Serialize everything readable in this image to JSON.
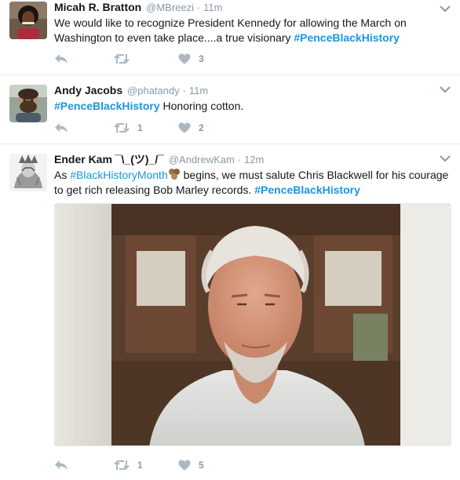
{
  "tweets": [
    {
      "name": "Micah R. Bratton",
      "handle": "@MBreezi",
      "separator": "·",
      "time": "11m",
      "text_part1": "We would like to recognize President Kennedy for allowing the March on Washington to even take place....a true visionary",
      "hashtag": "#PenceBlackHistory",
      "retweets": "",
      "likes": "3"
    },
    {
      "name": "Andy Jacobs",
      "handle": "@phatandy",
      "separator": "·",
      "time": "11m",
      "hashtag": "#PenceBlackHistory",
      "text_part2": "Honoring cotton.",
      "retweets": "1",
      "likes": "2"
    },
    {
      "name": "Ender Kam ¯\\_(ツ)_/¯",
      "handle": "@AndrewKam",
      "separator": "·",
      "time": "12m",
      "text_as": "As",
      "hashtag1": "#BlackHistoryMonth",
      "text_mid": "begins, we must salute Chris Blackwell for his courage to get rich releasing Bob Marley records.",
      "hashtag2": "#PenceBlackHistory",
      "retweets": "1",
      "likes": "5"
    }
  ],
  "icons": {
    "reply": "reply-arrow-icon",
    "retweet": "retweet-icon",
    "like": "heart-icon",
    "caret": "chevron-down-icon",
    "emoji": "cookie-emoji-icon"
  },
  "colors": {
    "hashtag": "#1b95e0",
    "meta": "#8899a6",
    "action": "#aab8c2",
    "divider": "#e6ecf0"
  }
}
